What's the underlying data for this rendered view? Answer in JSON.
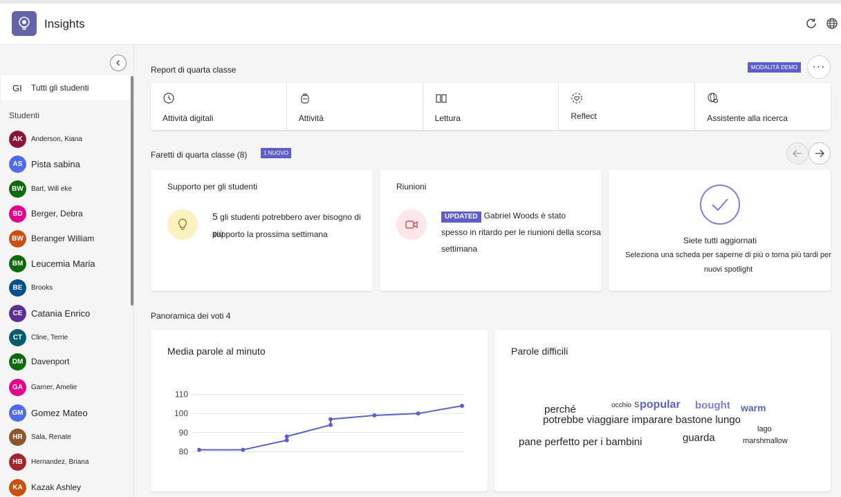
{
  "app": {
    "title": "Insights"
  },
  "icons": {
    "logo": "lightbulb-icon",
    "refresh": "refresh-icon",
    "globe": "globe-icon",
    "collapse": "chevron-left-icon"
  },
  "sidebar": {
    "all_students_initials": "GI",
    "all_students_label": "Tutti gli studenti",
    "students_header": "Studenti",
    "students": [
      {
        "initials": "AK",
        "name": "Anderson, Kiana",
        "color": "#8a1538"
      },
      {
        "initials": "AS",
        "name": "Pista sabina",
        "color": "#4f6bed"
      },
      {
        "initials": "BW",
        "name": "Bart, Will eke",
        "color": "#0b6a0b"
      },
      {
        "initials": "BD",
        "name": "Berger, Debra",
        "color": "#e3008c"
      },
      {
        "initials": "BW",
        "name": "Beranger William",
        "color": "#ca5010"
      },
      {
        "initials": "BM",
        "name": "Leucemia Maria",
        "color": "#0b6a0b"
      },
      {
        "initials": "BE",
        "name": "Brooks",
        "color": "#004e8c"
      },
      {
        "initials": "CE",
        "name": "Catania Enrico",
        "color": "#5c2e91"
      },
      {
        "initials": "CT",
        "name": "Cline, Terrie",
        "color": "#005b70"
      },
      {
        "initials": "DM",
        "name": "Davenport",
        "color": "#0b6a0b"
      },
      {
        "initials": "GA",
        "name": "Garner, Amelie",
        "color": "#e3008c"
      },
      {
        "initials": "GM",
        "name": "Gomez Mateo",
        "color": "#4f6bed"
      },
      {
        "initials": "HR",
        "name": "Sala, Renate",
        "color": "#8e562e"
      },
      {
        "initials": "HB",
        "name": "Hernandez, Briana",
        "color": "#a4262c"
      },
      {
        "initials": "KA",
        "name": "Kazak Ashley",
        "color": "#ca5010"
      }
    ]
  },
  "reports": {
    "title": "Report di quarta classe",
    "demo_badge": "MODALITÀ DEMO",
    "more": "···",
    "tabs": [
      {
        "label": "Attività digitali",
        "icon": "clock-icon"
      },
      {
        "label": "Attività",
        "icon": "backpack-icon"
      },
      {
        "label": "Lettura",
        "icon": "book-icon"
      },
      {
        "label": "Reflect",
        "icon": "heart-icon"
      },
      {
        "label": "Assistente alla ricerca",
        "icon": "globe-search-icon"
      }
    ]
  },
  "spotlights": {
    "title": "Faretti di quarta classe (8)",
    "new_badge": "1 NUOVO",
    "cards": {
      "support": {
        "title": "Supporto per gli studenti",
        "count": "5",
        "text_1": "gli studenti potrebbero aver bisogno di più",
        "text_2": "supporto la prossima settimana"
      },
      "meetings": {
        "title": "Riunioni",
        "badge": "UPDATED",
        "text_1": "Gabriel Woods è stato",
        "text_2": "spesso in ritardo per le riunioni della scorsa settimana"
      },
      "caught_up": {
        "title": "Siete tutti aggiornati",
        "text_1": "Seleziona una scheda per saperne di più o torna più tardi per",
        "text_2": "nuovi spotlight"
      }
    }
  },
  "grades": {
    "title": "Panoramica dei voti 4"
  },
  "wpm_card": {
    "title": "Media parole al minuto"
  },
  "words_card": {
    "title": "Parole difficili",
    "words": [
      {
        "text": "perché"
      },
      {
        "text": "occhio"
      },
      {
        "text": "S"
      },
      {
        "text": "popular"
      },
      {
        "text": "bought"
      },
      {
        "text": "warm"
      },
      {
        "text": "potrebbe viaggiare imparare bastone lungo"
      },
      {
        "text": "lago"
      },
      {
        "text": "pane perfetto per i bambini"
      },
      {
        "text": "guarda"
      },
      {
        "text": "marshmallow"
      }
    ]
  },
  "chart_data": {
    "type": "line",
    "title": "Media parole al minuto",
    "yticks": [
      80,
      90,
      100,
      110
    ],
    "ylim": [
      78,
      112
    ],
    "grid": true,
    "series": [
      {
        "values": [
          81,
          81,
          86,
          88,
          94,
          97,
          99,
          100,
          104
        ]
      }
    ],
    "x": [
      0,
      1,
      2,
      2,
      3,
      3,
      4,
      5,
      6
    ]
  }
}
